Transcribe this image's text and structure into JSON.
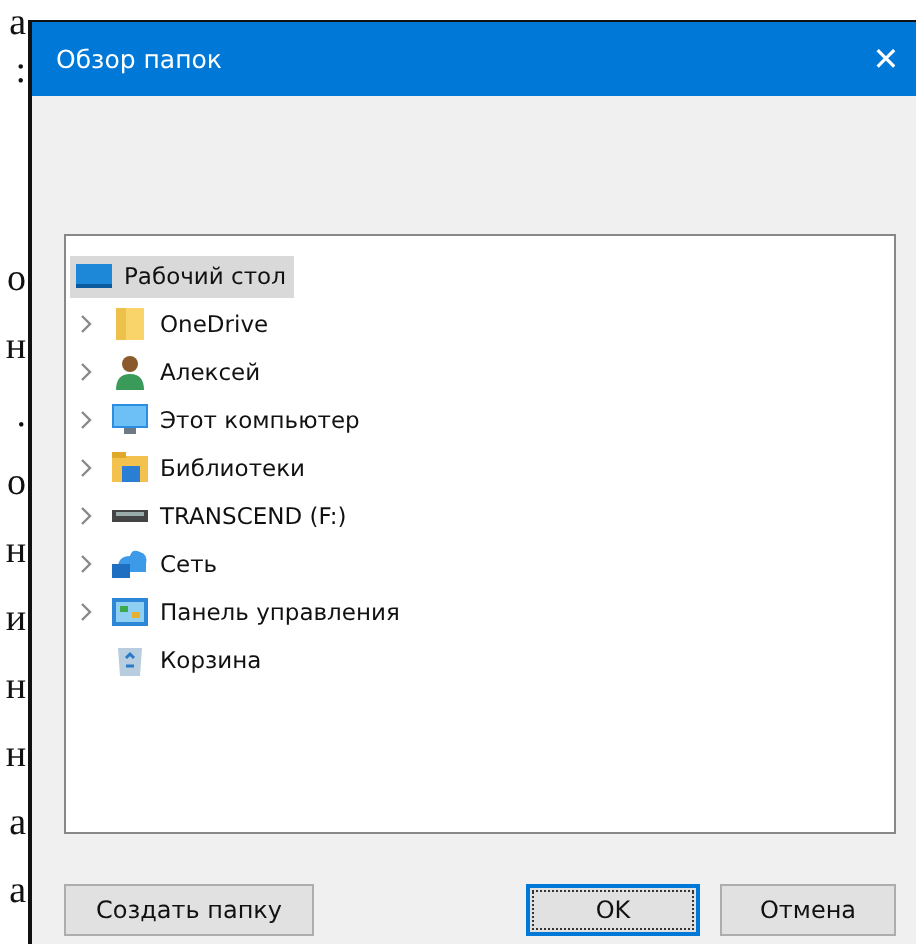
{
  "background_text": {
    "top_letters": [
      "а",
      ":"
    ],
    "letters": [
      "о",
      "н",
      ".",
      "о",
      "н",
      "и",
      "н",
      "н",
      "а",
      "а"
    ]
  },
  "window": {
    "title": "Обзор папок",
    "close": "✕"
  },
  "tree": {
    "root": {
      "label": "Рабочий стол",
      "kind": "desktop",
      "selected": true,
      "children": [
        {
          "label": "OneDrive",
          "kind": "folder",
          "expandable": true,
          "selected": false
        },
        {
          "label": "Алексей",
          "kind": "user",
          "expandable": true,
          "selected": false
        },
        {
          "label": "Этот компьютер",
          "kind": "computer",
          "expandable": true,
          "selected": false
        },
        {
          "label": "Библиотеки",
          "kind": "library",
          "expandable": true,
          "selected": false
        },
        {
          "label": "TRANSCEND (F:)",
          "kind": "drive",
          "expandable": true,
          "selected": false
        },
        {
          "label": "Сеть",
          "kind": "network",
          "expandable": true,
          "selected": false
        },
        {
          "label": "Панель управления",
          "kind": "control-panel",
          "expandable": true,
          "selected": false
        },
        {
          "label": "Корзина",
          "kind": "recycle-bin",
          "expandable": false,
          "selected": false
        }
      ]
    }
  },
  "buttons": [
    {
      "label": "Создать папку",
      "kind": "new-folder",
      "focused": false
    },
    {
      "label": "OK",
      "kind": "ok",
      "focused": true
    },
    {
      "label": "Отмена",
      "kind": "cancel",
      "focused": false
    }
  ]
}
